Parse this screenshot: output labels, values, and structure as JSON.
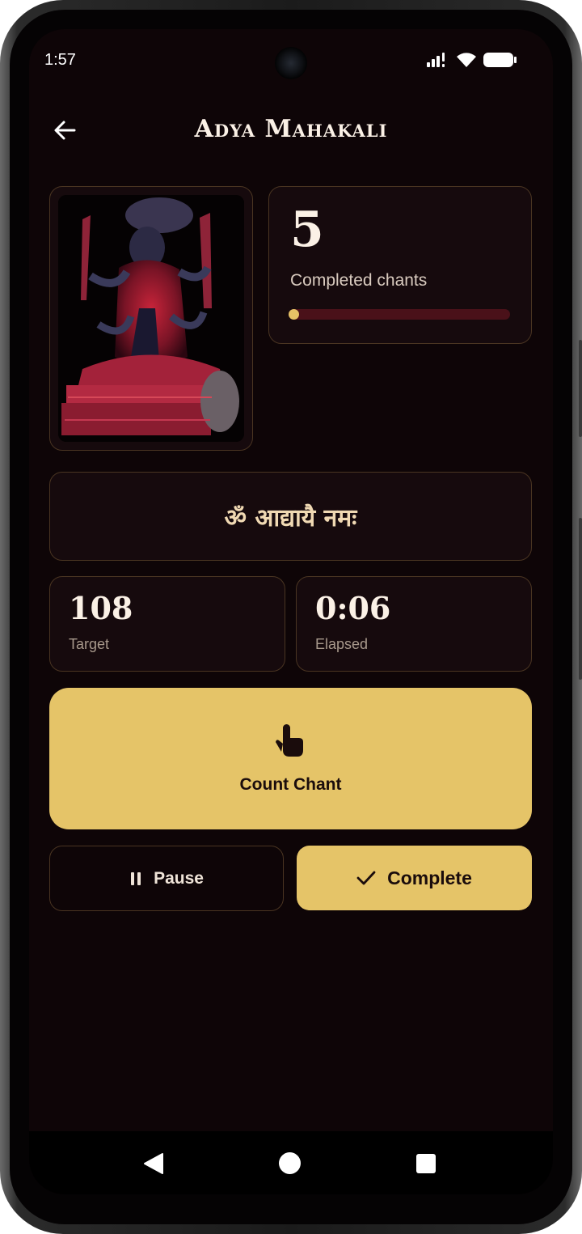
{
  "status_bar": {
    "time": "1:57"
  },
  "app_bar": {
    "title": "Adya Mahakali"
  },
  "counter": {
    "completed": "5",
    "label": "Completed chants",
    "progress_fraction": 0.0463
  },
  "mantra": {
    "text": "ॐ आद्यायै नमः"
  },
  "stats": {
    "target": {
      "value": "108",
      "label": "Target"
    },
    "elapsed": {
      "value": "0:06",
      "label": "Elapsed"
    }
  },
  "actions": {
    "count_label": "Count Chant",
    "pause_label": "Pause",
    "complete_label": "Complete"
  },
  "colors": {
    "accent": "#e5c468",
    "background": "#0e0507",
    "card": "#160a0d",
    "card_border": "#4a3522",
    "progress_track": "#4a1119"
  },
  "icons": {
    "back": "arrow-left-icon",
    "tap": "touch-icon",
    "pause": "pause-icon",
    "check": "check-icon"
  }
}
